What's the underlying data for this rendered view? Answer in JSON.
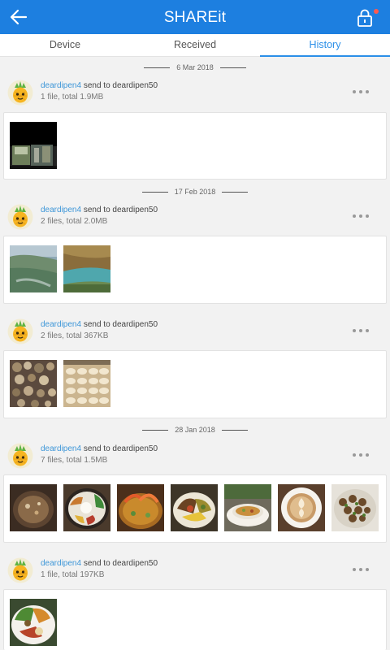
{
  "app": {
    "title": "SHAREit"
  },
  "tabs": [
    {
      "label": "Device"
    },
    {
      "label": "Received"
    },
    {
      "label": "History"
    }
  ],
  "dates": [
    "6 Mar 2018",
    "17 Feb 2018",
    "28 Jan 2018"
  ],
  "records": [
    {
      "sender": "deardipen4",
      "action": "send to deardipen50",
      "summary": "1 file, total 1.9MB"
    },
    {
      "sender": "deardipen4",
      "action": "send to deardipen50",
      "summary": "2 files, total 2.0MB"
    },
    {
      "sender": "deardipen4",
      "action": "send to deardipen50",
      "summary": "2 files, total 367KB"
    },
    {
      "sender": "deardipen4",
      "action": "send to deardipen50",
      "summary": "7 files, total 1.5MB"
    },
    {
      "sender": "deardipen4",
      "action": "send to deardipen50",
      "summary": "1 file, total 197KB"
    }
  ],
  "icons": {
    "back": "arrow-left-icon",
    "lock": "lock-icon",
    "more": "more-horizontal-icon",
    "avatar": "pineapple-avatar"
  },
  "colors": {
    "appbar": "#1d7fe0",
    "accent": "#2b8fe8",
    "sender": "#3d96d8",
    "notification": "#ff5a4e"
  }
}
